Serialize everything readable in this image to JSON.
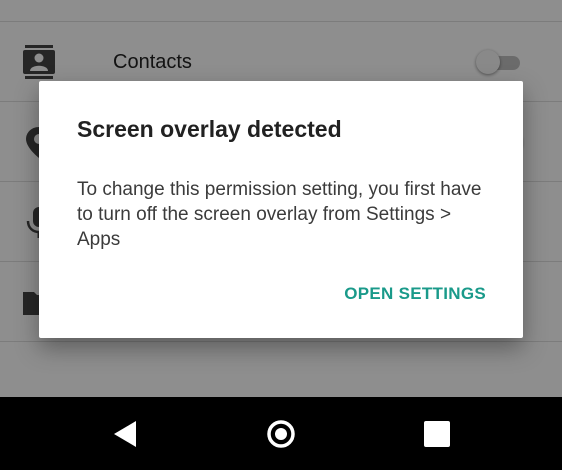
{
  "permissions": [
    {
      "label": "Contacts",
      "icon": "contacts-icon",
      "enabled": false
    },
    {
      "label": "",
      "icon": "location-icon",
      "enabled": true
    },
    {
      "label": "",
      "icon": "microphone-icon",
      "enabled": false
    },
    {
      "label": "",
      "icon": "storage-folder-icon",
      "enabled": false
    }
  ],
  "dialog": {
    "title": "Screen overlay detected",
    "message": "To change this permission setting, you first have to turn off the screen overlay from Settings > Apps",
    "action": "OPEN SETTINGS"
  },
  "navbar": {
    "back": "back-icon",
    "home": "home-icon",
    "recents": "recents-icon"
  },
  "colors": {
    "accent": "#1a9a8a",
    "toggle_on": "#00897b",
    "nav_background": "#000000",
    "scrim": "rgba(0,0,0,0.42)"
  }
}
